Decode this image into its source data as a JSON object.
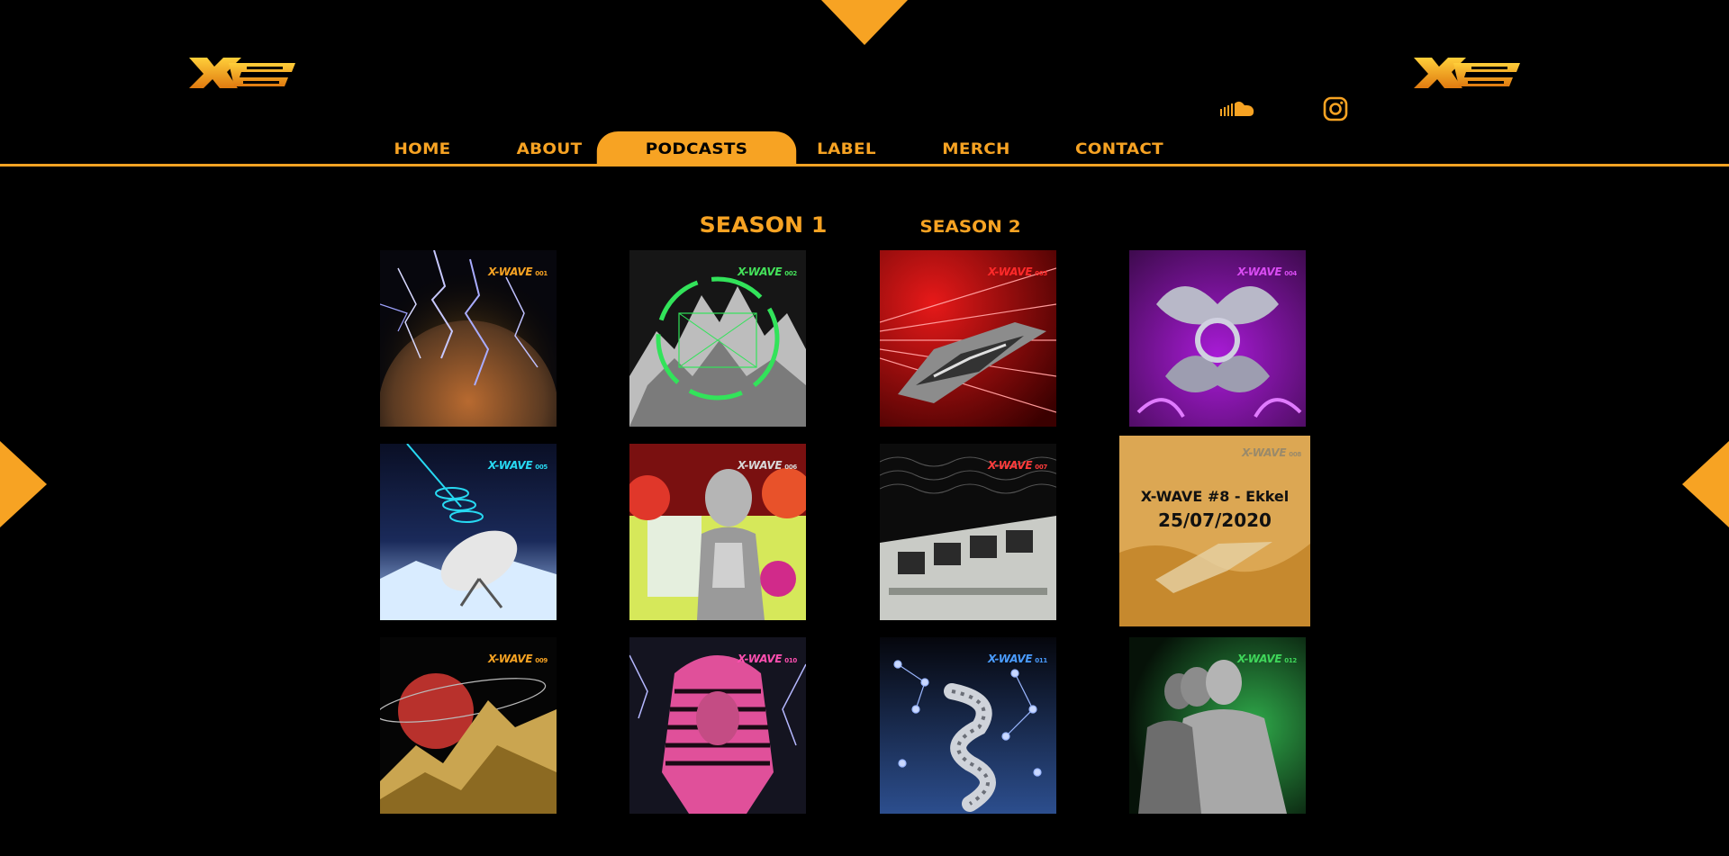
{
  "nav": {
    "items": [
      {
        "label": "HOME",
        "active": false
      },
      {
        "label": "ABOUT",
        "active": false
      },
      {
        "label": "PODCASTS",
        "active": true
      },
      {
        "label": "LABEL",
        "active": false
      },
      {
        "label": "MERCH",
        "active": false
      },
      {
        "label": "CONTACT",
        "active": false
      }
    ]
  },
  "seasons": {
    "s1": "SEASON 1",
    "s2": "SEASON 2"
  },
  "social": {
    "soundcloud": "soundcloud-icon",
    "instagram": "instagram-icon"
  },
  "tiles": [
    {
      "brand": "X-WAVE",
      "num": "001",
      "color": "#f7a323"
    },
    {
      "brand": "X-WAVE",
      "num": "002",
      "color": "#44e15a"
    },
    {
      "brand": "X-WAVE",
      "num": "003",
      "color": "#ff2a2a"
    },
    {
      "brand": "X-WAVE",
      "num": "004",
      "color": "#d94cf2"
    },
    {
      "brand": "X-WAVE",
      "num": "005",
      "color": "#27d9f2"
    },
    {
      "brand": "X-WAVE",
      "num": "006",
      "color": "#d8d8d8"
    },
    {
      "brand": "X-WAVE",
      "num": "007",
      "color": "#ff3b3b"
    },
    {
      "brand": "X-WAVE",
      "num": "008",
      "color": "#9a8a6a"
    },
    {
      "brand": "X-WAVE",
      "num": "009",
      "color": "#f7a323"
    },
    {
      "brand": "X-WAVE",
      "num": "010",
      "color": "#ff4fb0"
    },
    {
      "brand": "X-WAVE",
      "num": "011",
      "color": "#4a9cff"
    },
    {
      "brand": "X-WAVE",
      "num": "012",
      "color": "#3fd65a"
    }
  ],
  "ekkel": {
    "line1": "X-WAVE #8 - Ekkel",
    "line2": "25/07/2020"
  },
  "colors": {
    "accent": "#f7a323",
    "background": "#000000"
  }
}
